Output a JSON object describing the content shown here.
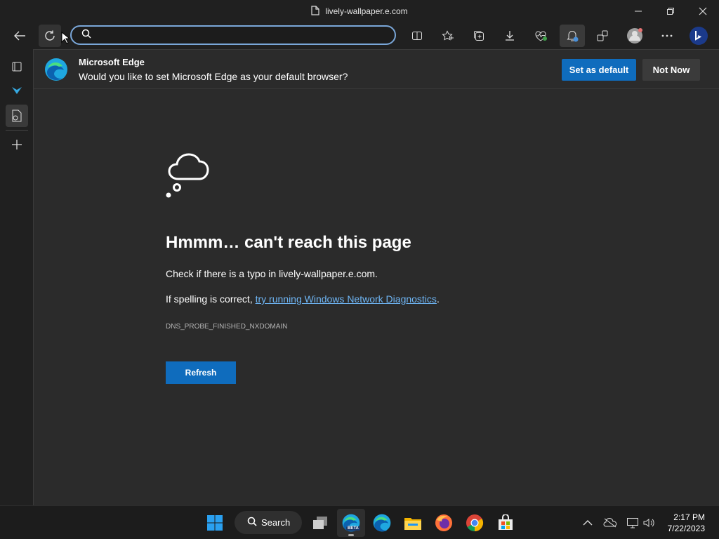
{
  "window": {
    "title": "lively-wallpaper.e.com"
  },
  "toolbar": {
    "address_value": "",
    "address_placeholder": ""
  },
  "infobar": {
    "title": "Microsoft Edge",
    "message": "Would you like to set Microsoft Edge as your default browser?",
    "primary_label": "Set as default",
    "secondary_label": "Not Now"
  },
  "error": {
    "title": "Hmmm… can't reach this page",
    "line1": "Check if there is a typo in lively-wallpaper.e.com.",
    "line2_prefix": "If spelling is correct, ",
    "line2_link": "try running Windows Network Diagnostics",
    "line2_suffix": ".",
    "code": "DNS_PROBE_FINISHED_NXDOMAIN",
    "refresh_label": "Refresh"
  },
  "taskbar": {
    "search_label": "Search",
    "time": "2:17 PM",
    "date": "7/22/2023",
    "beta_badge": "BETA"
  },
  "colors": {
    "accent": "#0f6cbd",
    "link": "#6fb6f5",
    "address_border": "#7aa7d9"
  }
}
